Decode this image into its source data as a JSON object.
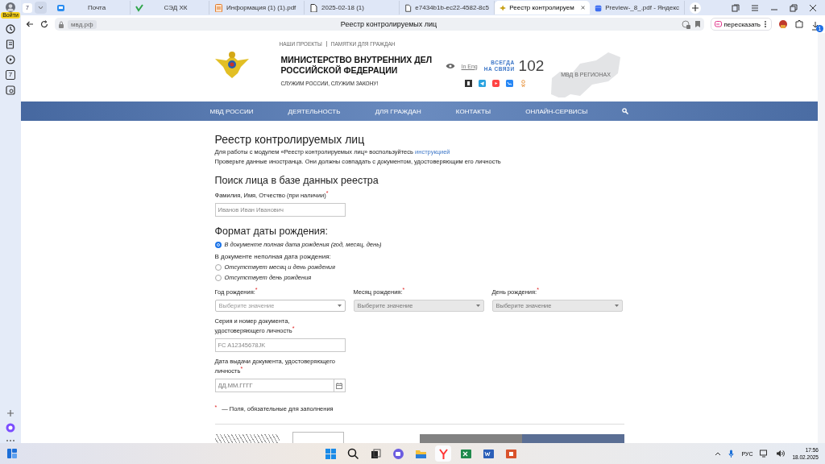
{
  "browser": {
    "sign_in": "Войти",
    "calendar_day": "7",
    "tab_count": "7",
    "tabs": [
      {
        "label": "Почта",
        "selected": false
      },
      {
        "label": "СЭД ХК",
        "selected": false
      },
      {
        "label": "Информация (1) (1).pdf",
        "selected": false
      },
      {
        "label": "2025-02-18 (1)",
        "selected": false
      },
      {
        "label": "e7434b1b-ec22-4582-8c5",
        "selected": false
      },
      {
        "label": "Реестр контролируем",
        "selected": true
      },
      {
        "label": "Preview-_8_.pdf - Яндекс",
        "selected": false
      }
    ],
    "address": "мвд.рф",
    "page_title": "Реестр контролируемых лиц",
    "retell": "пересказать",
    "downloads_badge": "1"
  },
  "site_header": {
    "top_links": [
      "НАШИ ПРОЕКТЫ",
      "ПАМЯТКИ ДЛЯ ГРАЖДАН"
    ],
    "org_name_lines": [
      "МИНИСТЕРСТВО ВНУТРЕННИХ ДЕЛ",
      "РОССИЙСКОЙ ФЕДЕРАЦИИ"
    ],
    "motto": "СЛУЖИМ РОССИИ, СЛУЖИМ ЗАКОНУ!",
    "lang_link": "In Eng",
    "hotline_lines": [
      "ВСЕГДА",
      "НА СВЯЗИ"
    ],
    "hotline_number": "102",
    "regions": "МВД В РЕГИОНАХ"
  },
  "nav": [
    "МВД РОССИИ",
    "ДЕЯТЕЛЬНОСТЬ",
    "ДЛЯ ГРАЖДАН",
    "КОНТАКТЫ",
    "ОНЛАЙН-СЕРВИСЫ"
  ],
  "form": {
    "title": "Реестр контролируемых лиц",
    "intro_text": "Для работы с модулем «Реестр контролируемых лиц» воспользуйтесь ",
    "intro_link": "инструкцией",
    "note": "Проверьте данные иностранца. Они должны совпадать с документом, удостоверяющим его личность",
    "search_title": "Поиск лица в базе данных реестра",
    "name_field": {
      "label": "Фамилия, Имя, Отчество (при наличии)",
      "required_mark": "*",
      "placeholder": "Иванов Иван Иванович"
    },
    "birth_format": {
      "title": "Формат даты рождения:",
      "items": [
        {
          "kind": "radio",
          "label": "В документе полная дата рождения (год, месяц, день)",
          "selected": true
        },
        {
          "kind": "subheading",
          "label": "В документе неполная дата рождения:"
        },
        {
          "kind": "radio",
          "label": "Отсутствует месяц и день рождения",
          "selected": false
        },
        {
          "kind": "radio",
          "label": "Отсутствует день рождения",
          "selected": false
        }
      ]
    },
    "birth_selects": [
      {
        "label": "Год рождения:",
        "required_mark": "*",
        "placeholder": "Выберите значение",
        "disabled": false
      },
      {
        "label": "Месяц рождения:",
        "required_mark": "*",
        "placeholder": "Выберите значение",
        "disabled": true
      },
      {
        "label": "День рождения:",
        "required_mark": "*",
        "placeholder": "Выберите значение",
        "disabled": true
      }
    ],
    "doc_number": {
      "label_lines": [
        "Серия и номер документа,",
        "удостоверяющего личность"
      ],
      "required_mark": "*",
      "placeholder": "FC A12345678JK"
    },
    "issue_date": {
      "label_lines": [
        "Дата выдачи документа, удостоверяющего",
        "личность"
      ],
      "required_mark": "*",
      "placeholder": "ДД.ММ.ГГГГ"
    },
    "required_note": {
      "mark": "*",
      "text": "— Поля, обязательные для заполнения"
    }
  },
  "taskbar": {
    "language": "РУС",
    "time": "17:56",
    "date": "18.02.2025"
  }
}
